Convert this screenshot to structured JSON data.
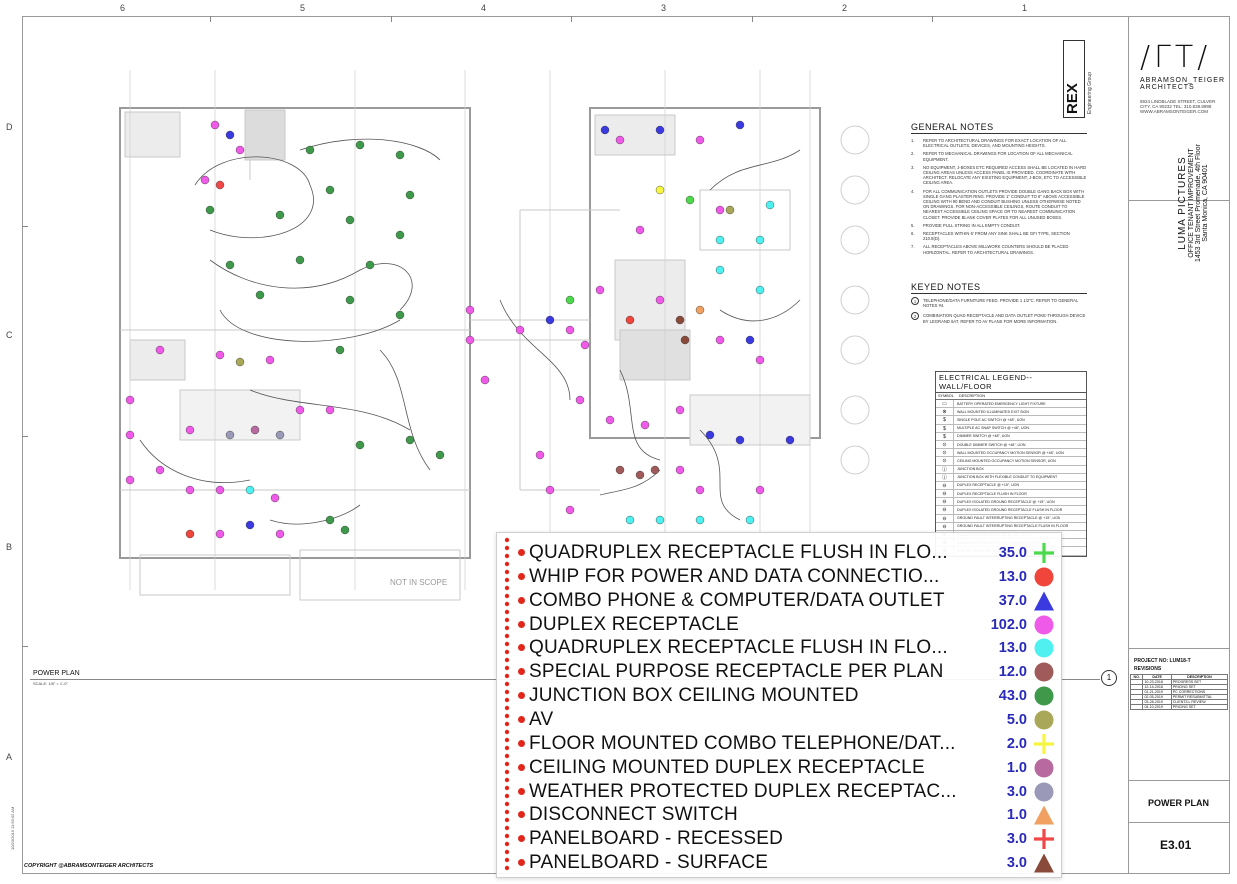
{
  "sheet": {
    "zone_columns": [
      "6",
      "5",
      "4",
      "3",
      "2",
      "1"
    ],
    "zone_rows": [
      "D",
      "C",
      "B",
      "A"
    ],
    "logo_mark": "/ΓT/",
    "firm_name": "ABRAMSON_TEIGER ARCHITECTS",
    "firm_address": "8924 LINDBLADE STREET, CULVER CITY, CA 90232   TEL: 310.838.8998   WWW.ABRAMSONTEIGER.COM",
    "engineer": "REX",
    "engineer_sub": "Engineering Group",
    "project_name": "LUMA PICTURES",
    "project_line1": "OFFICE TENANT IMPROVEMENT",
    "project_line2": "1453 3rd Street Promenade, 4th Floor",
    "project_line3": "Santa Monica, CA 90401",
    "project_no": "PROJECT NO: LUM18-T",
    "revisions_title": "REVISIONS",
    "revisions_headers": [
      "NO.",
      "DATE",
      "DESCRIPTION"
    ],
    "revisions": [
      [
        "",
        "10-23-2018",
        "PROGRESS SET"
      ],
      [
        "",
        "12-14-2018",
        "PRICING SET"
      ],
      [
        "",
        "01-21-2019",
        "PC CORRECTIONS"
      ],
      [
        "",
        "02-05-2019",
        "PERMIT RESUBMITTAL"
      ],
      [
        "",
        "03-28-2019",
        "CLIENT/LL REVIEW"
      ],
      [
        "",
        "04-10-2019",
        "PRICING SET"
      ]
    ],
    "sheet_title": "POWER PLAN",
    "sheet_number": "E3.01",
    "plan_title": "POWER PLAN",
    "plan_scale": "SCALE: 1/8\" = 1'-0\"",
    "plan_ref": "1",
    "copyright": "COPYRIGHT @ABRAMSONTEIGER ARCHITECTS",
    "date_stamp": "10/23/2019 11:50:02 AM",
    "not_in_scope": "NOT IN SCOPE"
  },
  "general_notes": {
    "title": "GENERAL NOTES",
    "items": [
      "REFER TO ARCHITECTURAL DRAWINGS FOR EXACT LOCATION OF ALL ELECTRICAL OUTLETS, DEVICES, AND MOUNTING HEIGHTS.",
      "REFER TO MECHANICAL DRAWINGS FOR LOCATION OF ALL MECHANICAL EQUIPMENT.",
      "NO EQUIPMENT, J-BOXES ETC REQUIRED ACCESS SHALL BE LOCATED IN HARD CEILING AREAS UNLESS ACCESS PANEL IS PROVIDED. COORDINATE WITH ARCHITECT. RELOCATE ANY EXISTING EQUIPMENT, J-BOX, ETC TO ACCESSIBLE CEILING AREA.",
      "FOR ALL COMMUNICATION OUTLETS PROVIDE DOUBLE GANG BACK BOX WITH SINGLE GANG PLASTER RING. PROVIDE 1\" CONDUIT TO 6\" ABOVE ACCESSIBLE CEILING WITH 90 BEND AND CONDUIT BUSHING UNLESS OTHERWISE NOTED ON DRAWINGS. FOR NON-ACCESSIBLE CEILINGS, ROUTE CONDUIT TO NEAREST ACCESSIBLE CEILING SPACE OR TO NEAREST COMMUNICATION CLOSET. PROVIDE BLANK COVER PLATES FOR ALL UNUSED BOXES.",
      "PROVIDE PULL STRING IN ALL EMPTY CONDUIT.",
      "RECEPTACLES WITHIN 6' FROM ANY SINK SHALL BE GFI TYPE, SECTION 210.8(D).",
      "ALL RECEPTACLES ABOVE MILLWORK COUNTERS SHOULD BE PLACED HORIZONTAL. REFER TO ARCHITECTURAL DRAWINGS."
    ]
  },
  "keyed_notes": {
    "title": "KEYED NOTES",
    "items": [
      "TELEPHONE/DATA FURNITURE FEED. PROVIDE 1 1/2\"C. REFER TO GENERAL NOTES #4.",
      "COMBINATION QUAD RECEPTACLE AND DATA OUTLET POKE-THROUGH DEVICE BY LEGRAND 6AT. REFER TO AV PLANS FOR MORE INFORMATION."
    ]
  },
  "electrical_legend": {
    "title": "ELECTRICAL LEGEND--WALL/FLOOR",
    "headers": [
      "SYMBOL",
      "DESCRIPTION"
    ],
    "rows": [
      [
        "▭",
        "BATTERY OPERATED EMERGENCY LIGHT FIXTURE"
      ],
      [
        "⊗",
        "WALL MOUNTED ILLUMINATED EXIT SIGN"
      ],
      [
        "$",
        "SINGLE POLE AC SWITCH @ +48\", UON"
      ],
      [
        "$",
        "MULTIPLE AC SNAP SWITCH @ +48\", UON"
      ],
      [
        "$",
        "DIMMER SWITCH @ +48\", UON"
      ],
      [
        "⊙",
        "DOUBLE DIMMER SWITCH @ +48\", UON"
      ],
      [
        "⊙",
        "WALL MOUNTED OCCUPANCY MOTION SENSOR @ +48\", UON"
      ],
      [
        "⊙",
        "CEILING MOUNTED OCCUPANCY MOTION SENSOR, UON"
      ],
      [
        "ⓙ",
        "JUNCTION BOX"
      ],
      [
        "ⓙ",
        "JUNCTION BOX WITH FLEXIBLE CONDUIT TO EQUIPMENT"
      ],
      [
        "⊖",
        "DUPLEX RECEPTACLE @ +15\", UON"
      ],
      [
        "⊖",
        "DUPLEX RECEPTACLE FLUSH IN FLOOR"
      ],
      [
        "⊖",
        "DUPLEX ISOLATED GROUND RECEPTACLE @ +15\", UON"
      ],
      [
        "⊖",
        "DUPLEX ISOLATED GROUND RECEPTACLE FLUSH IN FLOOR"
      ],
      [
        "⊖",
        "GROUND FAULT INTERRUPTING RECEPTACLE @ +15\", UON"
      ],
      [
        "⊖",
        "GROUND FAULT INTERRUPTING RECEPTACLE FLUSH IN FLOOR"
      ],
      [
        "⊕",
        "QUADRUPLEX RECEPTACLE @ +15\", U.O.N"
      ],
      [
        "⊕",
        "QUADRUPLEX RECEPTACLE FLUSH IN FLOOR, U.O.N"
      ],
      [
        "⊕",
        "SPECIAL PURPOSE RECEPTACLE PER PLAN @ +15\", UON"
      ]
    ]
  },
  "legend_overlay": {
    "items": [
      {
        "label": "QUADRUPLEX RECEPTACLE FLUSH IN FLO...",
        "count": "35.0",
        "symbol": "plus",
        "color": "#4cd94c"
      },
      {
        "label": "WHIP FOR POWER AND DATA CONNECTIO...",
        "count": "13.0",
        "symbol": "circle",
        "color": "#f0453a"
      },
      {
        "label": "COMBO PHONE & COMPUTER/DATA OUTLET",
        "count": "37.0",
        "symbol": "triangle",
        "color": "#3a3ae0"
      },
      {
        "label": "DUPLEX RECEPTACLE",
        "count": "102.0",
        "symbol": "circle",
        "color": "#f05ae8"
      },
      {
        "label": "QUADRUPLEX RECEPTACLE FLUSH IN FLO...",
        "count": "13.0",
        "symbol": "circle",
        "color": "#4ff0f0"
      },
      {
        "label": "SPECIAL PURPOSE RECEPTACLE PER PLAN",
        "count": "12.0",
        "symbol": "circle",
        "color": "#a05a5a"
      },
      {
        "label": "JUNCTION BOX CEILING MOUNTED",
        "count": "43.0",
        "symbol": "circle",
        "color": "#3e9a4a"
      },
      {
        "label": "AV",
        "count": "5.0",
        "symbol": "circle",
        "color": "#a8a858"
      },
      {
        "label": "FLOOR MOUNTED COMBO TELEPHONE/DAT...",
        "count": "2.0",
        "symbol": "plus",
        "color": "#f5f542"
      },
      {
        "label": "CEILING MOUNTED DUPLEX RECEPTACLE",
        "count": "1.0",
        "symbol": "circle",
        "color": "#b86aa0"
      },
      {
        "label": "WEATHER PROTECTED DUPLEX RECEPTAC...",
        "count": "3.0",
        "symbol": "circle",
        "color": "#9a9ab8"
      },
      {
        "label": "DISCONNECT SWITCH",
        "count": "1.0",
        "symbol": "triangle",
        "color": "#f0a060"
      },
      {
        "label": "PANELBOARD - RECESSED",
        "count": "3.0",
        "symbol": "plus",
        "color": "#f04848"
      },
      {
        "label": "PANELBOARD - SURFACE",
        "count": "3.0",
        "symbol": "triangle",
        "color": "#8a4a3a"
      }
    ]
  }
}
